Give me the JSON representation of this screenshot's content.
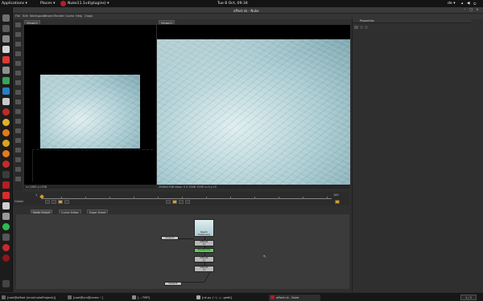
{
  "topbar": {
    "applications": "Applications ▾",
    "places": "Places ▾",
    "app_title": "Nuke11.1v4(plugins) ▾",
    "clock": "Tue  8 Oct, 09:34",
    "lang": "de ▾"
  },
  "window": {
    "title": "offset.nk - Nuke",
    "menus": [
      "File",
      "Edit",
      "Workspace",
      "Viewer",
      "Render",
      "Cache",
      "Help",
      "Ctags"
    ]
  },
  "viewer1": {
    "tab": "Viewer1",
    "status": "x=1265 y=508"
  },
  "viewer2": {
    "tab": "Viewer1",
    "status": "2048x1536 bbox: 0 0 2048 1536 x=0 y=0"
  },
  "timeline": {
    "frame_start": "1",
    "frame_end": "100",
    "fps_label": "Global"
  },
  "nodegraph": {
    "tabs": [
      "Node Graph",
      "Curve Editor",
      "Dope Sheet"
    ],
    "nodes": {
      "read": "Read1\nfreeze.png",
      "offset1": "Offset1\n(x)",
      "transform": "Transform1",
      "offset2": "Offset2\n(y)",
      "offset3": "Offset3\n(x)",
      "viewer_left": "Viewer1",
      "viewer_bottom": "Viewer1"
    }
  },
  "properties": {
    "title": "Properties"
  },
  "taskbar": {
    "items": [
      "[root@offset (/mnt/nukeProjects)]",
      "[root@vm@ceres:~]",
      "[...:TMP]",
      "[nk.py (~/...) - gedit]",
      "offset.nk - Nuke"
    ],
    "pager": "1 / 2"
  },
  "colors": {
    "accent_orange": "#e29a1a",
    "node_green": "#5fcf5a",
    "node_gray": "#b7b7b7"
  }
}
